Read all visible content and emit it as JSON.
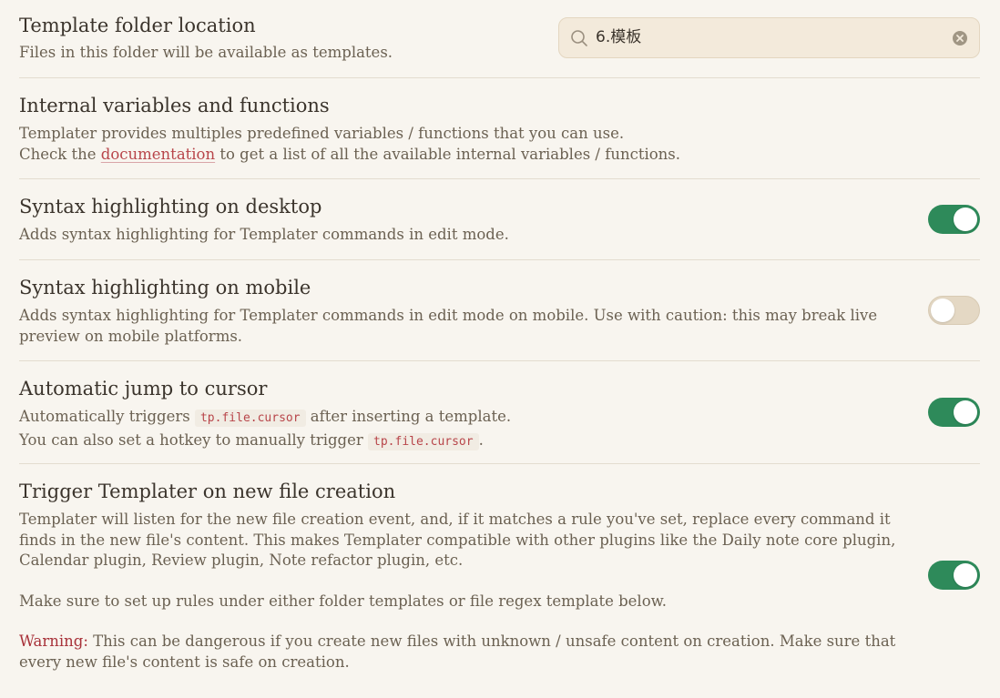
{
  "template_folder": {
    "name": "Template folder location",
    "desc": "Files in this folder will be available as templates.",
    "value": "6.模板"
  },
  "internal_vars": {
    "name": "Internal variables and functions",
    "desc_line1": "Templater provides multiples predefined variables / functions that you can use.",
    "desc_line2_prefix": "Check the ",
    "link_text": "documentation",
    "desc_line2_suffix": " to get a list of all the available internal variables / functions."
  },
  "syntax_desktop": {
    "name": "Syntax highlighting on desktop",
    "desc": "Adds syntax highlighting for Templater commands in edit mode.",
    "enabled": true
  },
  "syntax_mobile": {
    "name": "Syntax highlighting on mobile",
    "desc": "Adds syntax highlighting for Templater commands in edit mode on mobile. Use with caution: this may break live preview on mobile platforms.",
    "enabled": false
  },
  "auto_jump": {
    "name": "Automatic jump to cursor",
    "line1_prefix": "Automatically triggers ",
    "line1_code": "tp.file.cursor",
    "line1_suffix": " after inserting a template.",
    "line2_prefix": "You can also set a hotkey to manually trigger ",
    "line2_code": "tp.file.cursor",
    "line2_suffix": ".",
    "enabled": true
  },
  "trigger_new_file": {
    "name": "Trigger Templater on new file creation",
    "para1": "Templater will listen for the new file creation event, and, if it matches a rule you've set, replace every command it finds in the new file's content. This makes Templater compatible with other plugins like the Daily note core plugin, Calendar plugin, Review plugin, Note refactor plugin, etc.",
    "para2": "Make sure to set up rules under either folder templates or file regex template below.",
    "warning_label": "Warning:",
    "para3": " This can be dangerous if you create new files with unknown / unsafe content on creation. Make sure that every new file's content is safe on creation.",
    "enabled": true
  },
  "colors": {
    "toggle_on": "#2e8a5a",
    "toggle_off": "#e4d8c4",
    "link": "#b8454a",
    "warning": "#a8323a",
    "background": "#f8f5ef"
  },
  "icons": {
    "search": "search-icon",
    "clear": "clear-circle-icon"
  }
}
